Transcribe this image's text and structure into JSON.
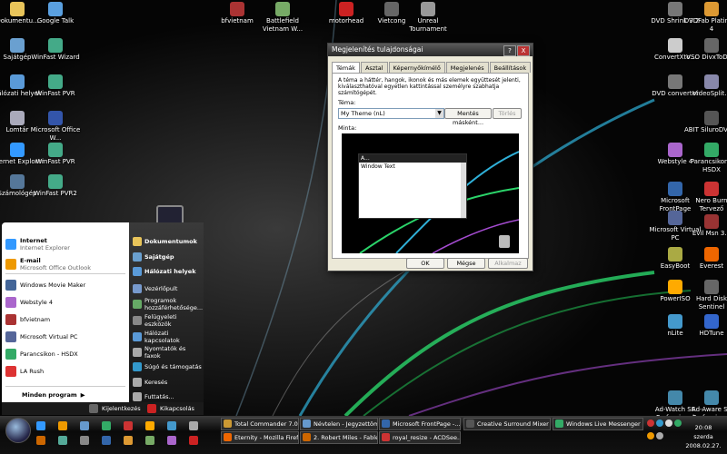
{
  "desktop": {
    "icons": [
      {
        "label": "Dokumentu...",
        "color": "#e8c45a"
      },
      {
        "label": "Google Talk",
        "color": "#5aa0e0"
      },
      {
        "label": "bfvietnam",
        "color": "#a33"
      },
      {
        "label": "Battlefield Vietnam W...",
        "color": "#7a6"
      },
      {
        "label": "motorhead",
        "color": "#c22"
      },
      {
        "label": "Vietcong",
        "color": "#666"
      },
      {
        "label": "Unreal Tournament",
        "color": "#999"
      },
      {
        "label": "DVD Shrink 3.2",
        "color": "#777"
      },
      {
        "label": "DVDFab Platinum 4",
        "color": "#d93"
      },
      {
        "label": "Sajátgép",
        "color": "#6aa0d0"
      },
      {
        "label": "WinFast Wizard",
        "color": "#4a8"
      },
      {
        "label": "ConvertXto...",
        "color": "#ccc"
      },
      {
        "label": "VSO DivxToDVD",
        "color": "#666"
      },
      {
        "label": "Hálózati helyek",
        "color": "#5a9ad8"
      },
      {
        "label": "WinFast PVR",
        "color": "#4a8"
      },
      {
        "label": "DVD converter",
        "color": "#777"
      },
      {
        "label": "VideoSplit...",
        "color": "#88a"
      },
      {
        "label": "Lomtár",
        "color": "#aab"
      },
      {
        "label": "Microsoft Office W...",
        "color": "#35a"
      },
      {
        "label": "ABIT SiluroDVD 4",
        "color": "#555"
      },
      {
        "label": "Internet Explorer",
        "color": "#39f"
      },
      {
        "label": "WinFast PVR",
        "color": "#4a8"
      },
      {
        "label": "Webstyle 4",
        "color": "#a6c"
      },
      {
        "label": "Parancsikon - HSDX",
        "color": "#3a6"
      },
      {
        "label": "Számológép",
        "color": "#579"
      },
      {
        "label": "WinFast PVR2",
        "color": "#4a8"
      },
      {
        "label": "Microsoft FrontPage",
        "color": "#36a"
      },
      {
        "label": "Nero Burn Tervező",
        "color": "#c33"
      },
      {
        "label": "Microsoft Virtual PC",
        "color": "#569"
      },
      {
        "label": "Evil Msn 3.0",
        "color": "#933"
      },
      {
        "label": "EasyBoot",
        "color": "#aa4"
      },
      {
        "label": "Everest",
        "color": "#e60"
      },
      {
        "label": "PowerISO",
        "color": "#fa0"
      },
      {
        "label": "Hard Disk Sentinel",
        "color": "#666"
      },
      {
        "label": "nLite",
        "color": "#49c"
      },
      {
        "label": "HDTune",
        "color": "#36c"
      },
      {
        "label": "Ad-Watch SE Professional",
        "color": "#48a"
      },
      {
        "label": "Ad-Aware SE Professional",
        "color": "#48a"
      }
    ]
  },
  "dialog": {
    "title": "Megjelenítés tulajdonságai",
    "help_btn": "?",
    "close_btn": "X",
    "tabs": [
      "Témák",
      "Asztal",
      "Képernyőkímélő",
      "Megjelenés",
      "Beállítások"
    ],
    "description": "A téma a háttér, hangok, ikonok és más elemek együttesét jelenti, kiválaszthatóval egyetlen kattintással személyre szabhatja számítógépét.",
    "theme_label": "Téma:",
    "theme_value": "My Theme (nL)",
    "save_as": "Mentés másként...",
    "delete": "Törlés",
    "preview_label": "Minta:",
    "preview_window_title": "A...",
    "preview_window_text": "Window Text",
    "ok": "OK",
    "cancel": "Mégse",
    "apply": "Alkalmaz"
  },
  "startmenu": {
    "pinned": [
      {
        "title": "Internet",
        "sub": "Internet Explorer",
        "color": "#39f"
      },
      {
        "title": "E-mail",
        "sub": "Microsoft Office Outlook",
        "color": "#e90"
      }
    ],
    "recent": [
      {
        "label": "Windows Movie Maker",
        "color": "#469"
      },
      {
        "label": "Webstyle 4",
        "color": "#a6c"
      },
      {
        "label": "bfvietnam",
        "color": "#a33"
      },
      {
        "label": "Microsoft Virtual PC",
        "color": "#569"
      },
      {
        "label": "Parancsikon - HSDX",
        "color": "#3a6"
      },
      {
        "label": "LA Rush",
        "color": "#d33"
      }
    ],
    "all_programs": "Minden program",
    "right": [
      {
        "label": "Dokumentumok",
        "bold": true,
        "color": "#e8c45a"
      },
      {
        "label": "Sajátgép",
        "bold": true,
        "color": "#6aa0d0"
      },
      {
        "label": "Hálózati helyek",
        "bold": true,
        "color": "#5a9ad8"
      },
      {
        "label": "Vezérlőpult",
        "bold": false,
        "color": "#79c"
      },
      {
        "label": "Programok hozzáférhetősége...",
        "bold": false,
        "color": "#6a6"
      },
      {
        "label": "Felügyeleti eszközök",
        "bold": false,
        "color": "#888"
      },
      {
        "label": "Hálózati kapcsolatok",
        "bold": false,
        "color": "#5a9ad8"
      },
      {
        "label": "Nyomtatók és faxok",
        "bold": false,
        "color": "#aaa"
      },
      {
        "label": "Súgó és támogatás",
        "bold": false,
        "color": "#39c"
      },
      {
        "label": "Keresés",
        "bold": false,
        "color": "#aaa"
      },
      {
        "label": "Futtatás...",
        "bold": false,
        "color": "#aaa"
      }
    ],
    "logoff": "Kijelentkezés",
    "shutdown": "Kikapcsolás"
  },
  "taskbar": {
    "tasks": [
      {
        "label": "Total Commander 7.0...",
        "color": "#c93"
      },
      {
        "label": "Névtelen - Jegyzettömb",
        "color": "#69c"
      },
      {
        "label": "Microsoft FrontPage -...",
        "color": "#36a"
      },
      {
        "label": "Creative Surround Mixer",
        "color": "#555"
      },
      {
        "label": "Windows Live Messenger",
        "color": "#3a6"
      },
      {
        "label": "Eternity - Mozilla Firefox",
        "color": "#e60"
      },
      {
        "label": "2. Robert Miles - Fable...",
        "color": "#c60"
      },
      {
        "label": "royal_resize - ACDSee...",
        "color": "#c33"
      }
    ],
    "clock_time": "20:08",
    "clock_day": "szerda",
    "clock_date": "2008.02.27."
  }
}
